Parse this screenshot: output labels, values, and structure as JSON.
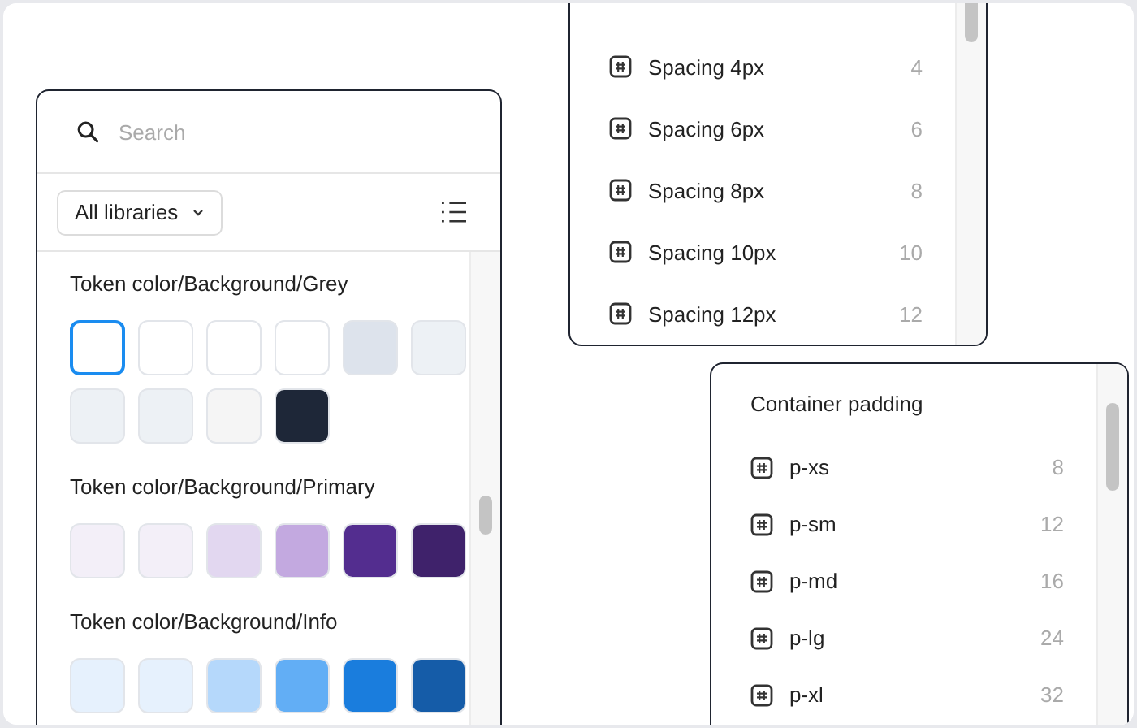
{
  "library_panel": {
    "search": {
      "placeholder": "Search"
    },
    "filter": {
      "label": "All libraries"
    },
    "groups": [
      {
        "title": "Token color/Background/Grey",
        "swatches": [
          {
            "color": "#ffffff",
            "selected": true
          },
          {
            "color": "#ffffff",
            "selected": false
          },
          {
            "color": "#ffffff",
            "selected": false
          },
          {
            "color": "#ffffff",
            "selected": false
          },
          {
            "color": "#dde3ec",
            "selected": false
          },
          {
            "color": "#edf1f5",
            "selected": false
          },
          {
            "color": "#edf1f5",
            "selected": false
          },
          {
            "color": "#edf1f5",
            "selected": false
          },
          {
            "color": "#f5f5f5",
            "selected": false
          },
          {
            "color": "#1e2738",
            "selected": false
          }
        ]
      },
      {
        "title": "Token color/Background/Primary",
        "swatches": [
          {
            "color": "#f3eff8",
            "selected": false
          },
          {
            "color": "#f3eff8",
            "selected": false
          },
          {
            "color": "#e2d7f0",
            "selected": false
          },
          {
            "color": "#c3a9e0",
            "selected": false
          },
          {
            "color": "#532d8f",
            "selected": false
          },
          {
            "color": "#3f226b",
            "selected": false
          }
        ]
      },
      {
        "title": "Token color/Background/Info",
        "swatches": [
          {
            "color": "#e6f1fd",
            "selected": false
          },
          {
            "color": "#e6f1fd",
            "selected": false
          },
          {
            "color": "#b5d8fb",
            "selected": false
          },
          {
            "color": "#62aef5",
            "selected": false
          },
          {
            "color": "#1a7ddd",
            "selected": false
          },
          {
            "color": "#155ca8",
            "selected": false
          }
        ]
      }
    ]
  },
  "spacing_panel": {
    "items": [
      {
        "label": "Spacing 4px",
        "value": "4"
      },
      {
        "label": "Spacing 6px",
        "value": "6"
      },
      {
        "label": "Spacing 8px",
        "value": "8"
      },
      {
        "label": "Spacing 10px",
        "value": "10"
      },
      {
        "label": "Spacing 12px",
        "value": "12"
      }
    ]
  },
  "padding_panel": {
    "title": "Container padding",
    "items": [
      {
        "label": "p-xs",
        "value": "8"
      },
      {
        "label": "p-sm",
        "value": "12"
      },
      {
        "label": "p-md",
        "value": "16"
      },
      {
        "label": "p-lg",
        "value": "24"
      },
      {
        "label": "p-xl",
        "value": "32"
      }
    ]
  }
}
